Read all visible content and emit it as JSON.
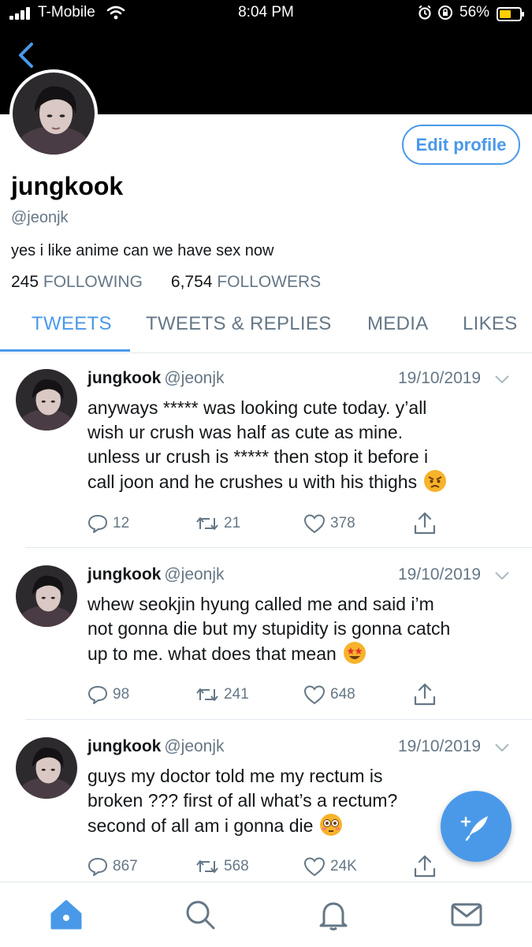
{
  "status_bar": {
    "carrier": "T-Mobile",
    "time": "8:04 PM",
    "battery": "56%",
    "battery_color": "#ffcc00"
  },
  "header": {
    "back_icon": "chevron-left-icon"
  },
  "profile": {
    "name": "jungkook",
    "handle": "@jeonjk",
    "bio": "yes i like anime can we have sex now",
    "following_count": "245",
    "following_label": "FOLLOWING",
    "followers_count": "6,754",
    "followers_label": "FOLLOWERS",
    "edit_label": "Edit profile"
  },
  "tabs": [
    {
      "label": "TWEETS",
      "active": true
    },
    {
      "label": "TWEETS & REPLIES",
      "active": false
    },
    {
      "label": "MEDIA",
      "active": false
    },
    {
      "label": "LIKES",
      "active": false
    }
  ],
  "tweets": [
    {
      "name": "jungkook",
      "handle": "@jeonjk",
      "date": "19/10/2019",
      "lines": [
        "anyways ***** was looking cute today. y’all",
        "wish ur crush was half as cute as mine.",
        "unless ur crush is ***** then stop it before i",
        "call joon and he crushes u with his thighs"
      ],
      "emoji": "angry-face-emoji",
      "replies": "12",
      "retweets": "21",
      "likes": "378"
    },
    {
      "name": "jungkook",
      "handle": "@jeonjk",
      "date": "19/10/2019",
      "lines": [
        "whew seokjin hyung called me and said i’m",
        "not gonna die but my stupidity is gonna catch",
        "up to me. what does that mean"
      ],
      "emoji": "star-struck-emoji",
      "replies": "98",
      "retweets": "241",
      "likes": "648"
    },
    {
      "name": "jungkook",
      "handle": "@jeonjk",
      "date": "19/10/2019",
      "lines": [
        "guys my doctor told me my rectum is",
        "broken ??? first of all what’s a rectum?",
        "second of all am i gonna die"
      ],
      "emoji": "flushed-face-emoji",
      "replies": "867",
      "retweets": "568",
      "likes": "24K"
    }
  ],
  "colors": {
    "accent": "#4a99e9",
    "muted": "#657786",
    "text": "#14171a",
    "border": "#e1e8ed"
  },
  "bottom_nav": [
    "home-icon",
    "search-icon",
    "notifications-icon",
    "messages-icon"
  ]
}
